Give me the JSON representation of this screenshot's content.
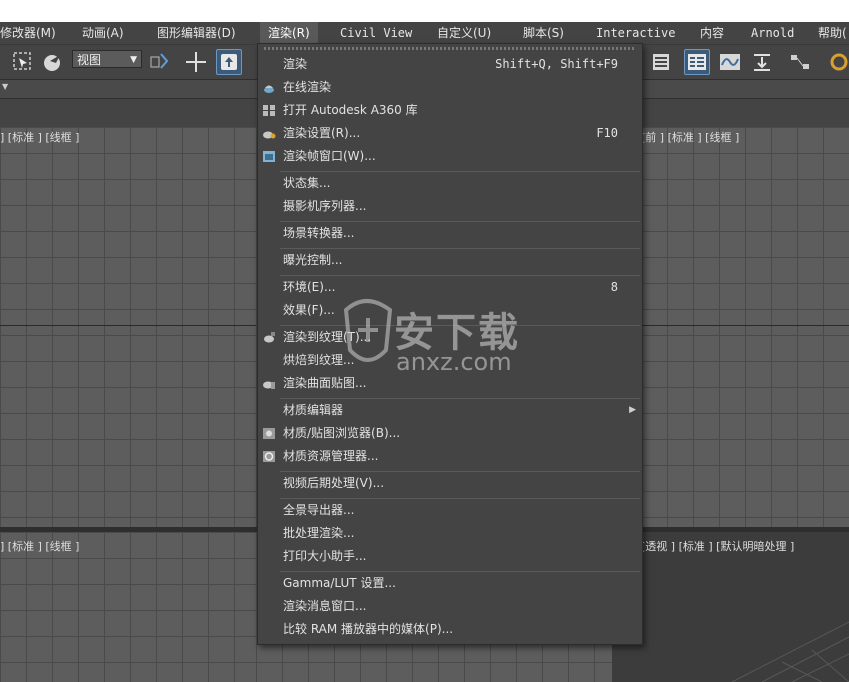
{
  "menubar": {
    "items": [
      {
        "label": "修改器(M)"
      },
      {
        "label": "动画(A)"
      },
      {
        "label": "图形编辑器(D)"
      },
      {
        "label": "渲染(R)"
      },
      {
        "label": "Civil View"
      },
      {
        "label": "自定义(U)"
      },
      {
        "label": "脚本(S)"
      },
      {
        "label": "Interactive"
      },
      {
        "label": "内容"
      },
      {
        "label": "Arnold"
      },
      {
        "label": "帮助("
      }
    ]
  },
  "toolbar": {
    "view_select": "视图"
  },
  "viewports": {
    "top_left": "] [标准 ] [线框 ]",
    "top_right": "[前 ] [标准 ] [线框 ]",
    "bottom_left": "] [标准 ] [线框 ]",
    "bottom_right": "[透视 ] [标准 ] [默认明暗处理 ]"
  },
  "render_menu": {
    "items": [
      {
        "label": "渲染",
        "shortcut": "Shift+Q, Shift+F9",
        "icon": ""
      },
      {
        "label": "在线渲染",
        "shortcut": "",
        "icon": "teapot-cloud-icon"
      },
      {
        "label": "打开 Autodesk A360 库",
        "shortcut": "",
        "icon": "gallery-grid-icon"
      },
      {
        "label": "渲染设置(R)...",
        "shortcut": "F10",
        "icon": "render-setup-teapot-icon"
      },
      {
        "label": "渲染帧窗口(W)...",
        "shortcut": "",
        "icon": "frame-window-icon"
      },
      {
        "label": "状态集...",
        "shortcut": "",
        "icon": ""
      },
      {
        "label": "摄影机序列器...",
        "shortcut": "",
        "icon": ""
      },
      {
        "label": "场景转换器...",
        "shortcut": "",
        "icon": ""
      },
      {
        "label": "曝光控制...",
        "shortcut": "",
        "icon": ""
      },
      {
        "label": "环境(E)...",
        "shortcut": "8",
        "icon": ""
      },
      {
        "label": "效果(F)...",
        "shortcut": "",
        "icon": ""
      },
      {
        "label": "渲染到纹理(T)...",
        "shortcut": "",
        "icon": "render-texture-icon"
      },
      {
        "label": "烘焙到纹理...",
        "shortcut": "",
        "icon": ""
      },
      {
        "label": "渲染曲面贴图...",
        "shortcut": "",
        "icon": "surface-map-icon"
      },
      {
        "label": "材质编辑器",
        "shortcut": "",
        "icon": "",
        "submenu": true
      },
      {
        "label": "材质/贴图浏览器(B)...",
        "shortcut": "",
        "icon": "material-browser-icon"
      },
      {
        "label": "材质资源管理器...",
        "shortcut": "",
        "icon": "material-explorer-icon"
      },
      {
        "label": "视频后期处理(V)...",
        "shortcut": "",
        "icon": ""
      },
      {
        "label": "全景导出器...",
        "shortcut": "",
        "icon": ""
      },
      {
        "label": "批处理渲染...",
        "shortcut": "",
        "icon": ""
      },
      {
        "label": "打印大小助手...",
        "shortcut": "",
        "icon": ""
      },
      {
        "label": "Gamma/LUT 设置...",
        "shortcut": "",
        "icon": ""
      },
      {
        "label": "渲染消息窗口...",
        "shortcut": "",
        "icon": ""
      },
      {
        "label": "比较 RAM 播放器中的媒体(P)...",
        "shortcut": "",
        "icon": ""
      }
    ]
  },
  "watermark": {
    "text_cn": "安下载",
    "text_en": "anxz.com"
  },
  "colors": {
    "background": "#444444",
    "viewport": "#5d5d5d",
    "grid": "#4a4a4a",
    "menu_active": "#595959",
    "accent_blue": "#3c5b7a"
  }
}
